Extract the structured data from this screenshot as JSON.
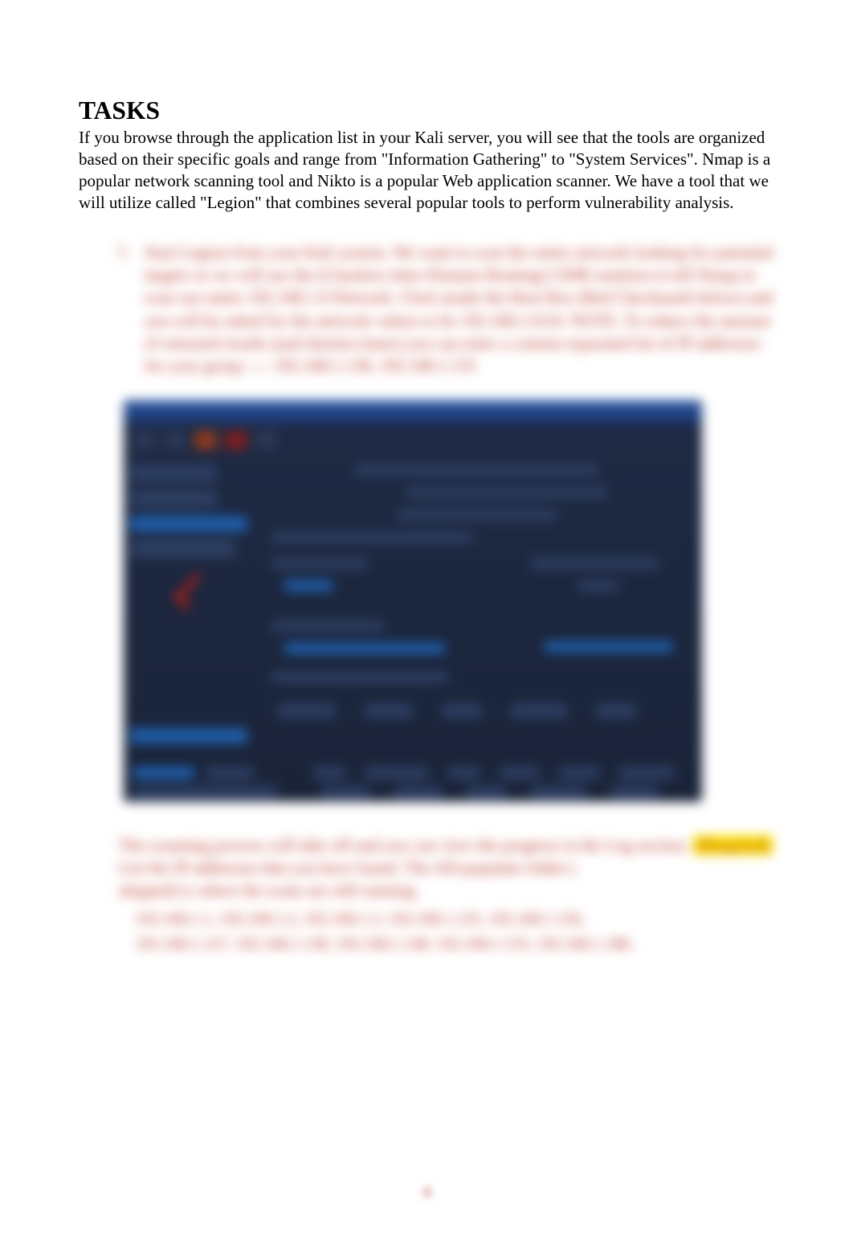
{
  "heading": "TASKS",
  "intro": "If you browse through the application list in your Kali server, you will see that the tools are organized based on their specific goals and range from \"Information Gathering\" to \"System Services\". Nmap is a popular network scanning tool and Nikto is a popular Web application scanner. We have a tool that we will utilize called \"Legion\" that combines several popular tools to perform vulnerability analysis.",
  "step": {
    "number": "1.",
    "text": "Start Legion from your Kali system. We want to scan the entire network looking for potential targets so we will use the (Classless Inter-Domain Routing) CIDR notation to tell Nmap to scan our entire 192.168.1.0 Network. Click inside the Host Box (Red Checkmark below) and you will be asked for the network values to be 192.168.1.0/24. NOTE: To reduce the amount of returned results (and shorten times) you can enter a comma separated list of IP addresses for your group ---- 192.168.1.138, 192.168.1.155"
  },
  "bottom": {
    "line1": "The scanning process will take off and you can view the progress in the Log section.",
    "highlight_label": "(Required)",
    "line1b": "List the IP addresses that you have found. The AD-populate folder (",
    "line2": "skipped) is where the scans are still running.",
    "ips_a": "192.168.1.1, 192.168.1.2, 192.168.1.3, 192.168.1.125, 192.168.1.126,",
    "ips_b": "192.168.1.127, 192.168.1.138, 192.168.1.148, 192.168.1.155, 192.168.1.188,"
  },
  "page_number": "4"
}
